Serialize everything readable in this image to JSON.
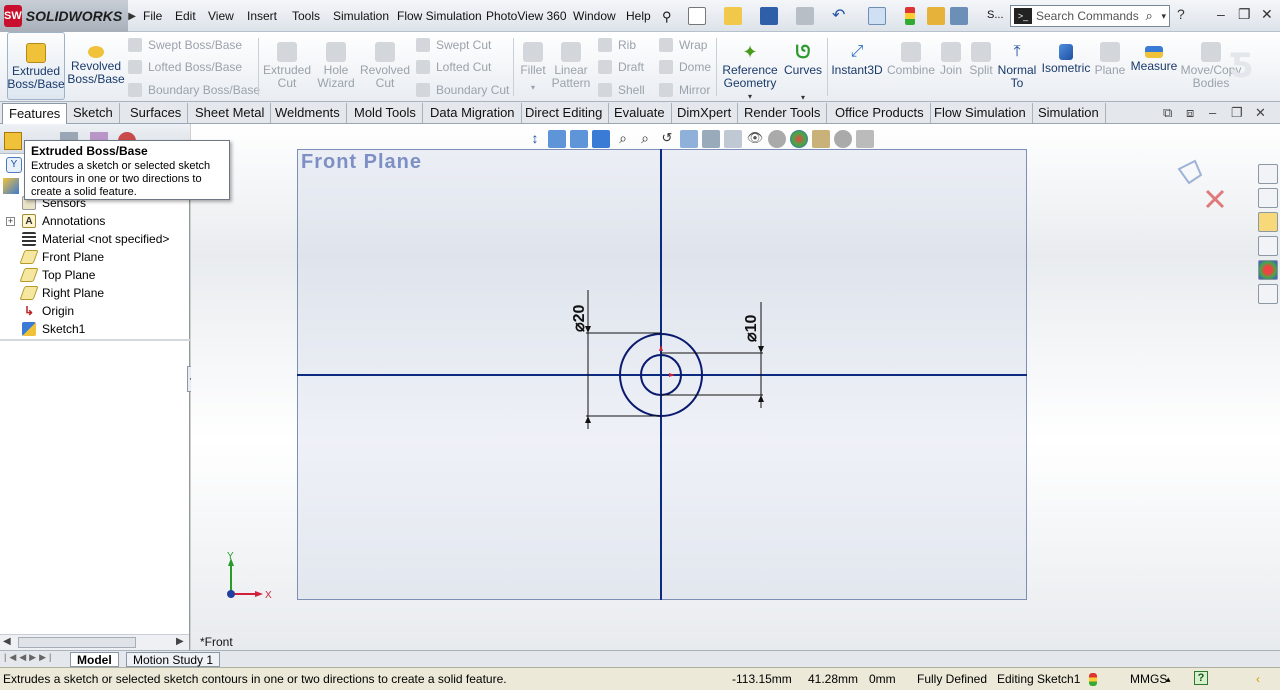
{
  "app": {
    "name": "SOLIDWORKS",
    "logo_mark": "SW"
  },
  "menu": [
    "File",
    "Edit",
    "View",
    "Insert",
    "Tools",
    "Simulation",
    "Flow Simulation",
    "PhotoView 360",
    "Window",
    "Help"
  ],
  "search": {
    "placeholder": "Search Commands",
    "overflow_label": "S..."
  },
  "command_manager": {
    "extruded_boss": "Extruded\nBoss/Base",
    "revolved_boss": "Revolved\nBoss/Base",
    "swept_boss": "Swept Boss/Base",
    "lofted_boss": "Lofted Boss/Base",
    "boundary_boss": "Boundary Boss/Base",
    "extruded_cut": "Extruded\nCut",
    "hole_wizard": "Hole\nWizard",
    "revolved_cut": "Revolved\nCut",
    "swept_cut": "Swept Cut",
    "lofted_cut": "Lofted Cut",
    "boundary_cut": "Boundary Cut",
    "fillet": "Fillet",
    "linear_pattern": "Linear\nPattern",
    "rib": "Rib",
    "draft": "Draft",
    "shell": "Shell",
    "wrap": "Wrap",
    "dome": "Dome",
    "mirror": "Mirror",
    "reference_geometry": "Reference\nGeometry",
    "curves": "Curves",
    "instant3d": "Instant3D",
    "combine": "Combine",
    "join": "Join",
    "split": "Split",
    "normal_to": "Normal\nTo",
    "isometric": "Isometric",
    "plane": "Plane",
    "measure": "Measure",
    "move_copy": "Move/Copy\nBodies"
  },
  "tabs": [
    "Features",
    "Sketch",
    "Surfaces",
    "Sheet Metal",
    "Weldments",
    "Mold Tools",
    "Data Migration",
    "Direct Editing",
    "Evaluate",
    "DimXpert",
    "Render Tools",
    "Office Products",
    "Flow Simulation",
    "Simulation"
  ],
  "tooltip": {
    "title": "Extruded Boss/Base",
    "description": "Extrudes a sketch or selected sketch contours in one or two directions to create a solid feature."
  },
  "tree": {
    "items": [
      {
        "label": "Sensors",
        "icon": "sensors-icon"
      },
      {
        "label": "Annotations",
        "icon": "annotations-icon",
        "expandable": true
      },
      {
        "label": "Material <not specified>",
        "icon": "material-icon"
      },
      {
        "label": "Front Plane",
        "icon": "plane-icon"
      },
      {
        "label": "Top Plane",
        "icon": "plane-icon"
      },
      {
        "label": "Right Plane",
        "icon": "plane-icon"
      },
      {
        "label": "Origin",
        "icon": "origin-icon"
      },
      {
        "label": "Sketch1",
        "icon": "sketch-icon"
      }
    ]
  },
  "graphics": {
    "plane_name": "Front Plane",
    "view_name": "*Front",
    "dimension_outer": "⌀20",
    "dimension_inner": "⌀10",
    "outer_diameter_mm": 20,
    "inner_diameter_mm": 10,
    "triad_x": "X",
    "triad_y": "Y"
  },
  "bottom_tabs": [
    "Model",
    "Motion Study 1"
  ],
  "status": {
    "message": "Extrudes a sketch or selected sketch contours in one or two directions to create a solid feature.",
    "x": "-113.15mm",
    "y": "41.28mm",
    "z": "0mm",
    "state": "Fully Defined",
    "editing": "Editing Sketch1",
    "units": "MMGS",
    "help": "?"
  },
  "colors": {
    "accent": "#1a3a6b",
    "sketch_line": "#0a1a6e",
    "axis_line": "#0b2a80",
    "plane_title": "#7d8fc4"
  }
}
